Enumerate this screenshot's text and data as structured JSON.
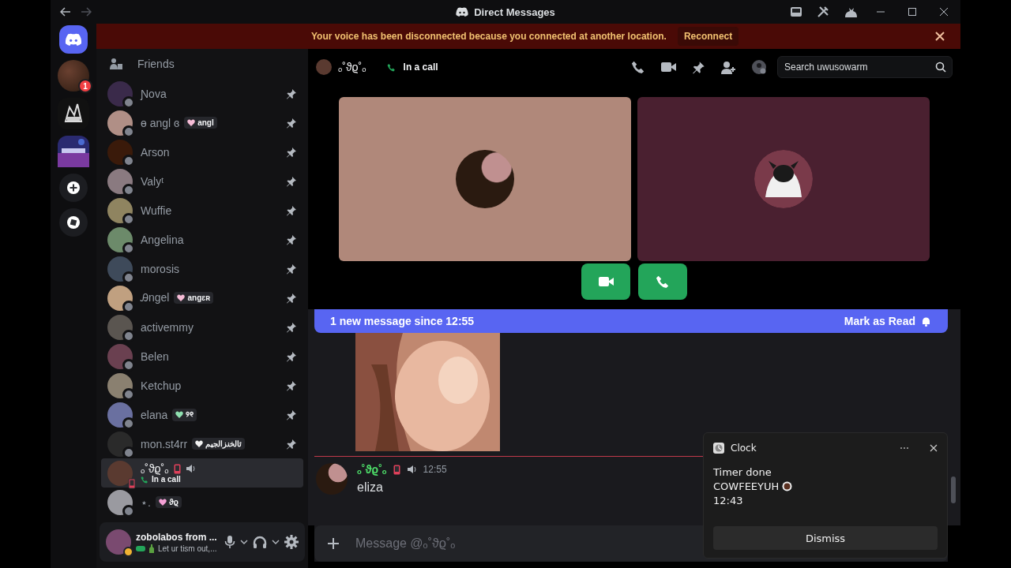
{
  "window": {
    "title": "Direct Messages"
  },
  "banner": {
    "text": "Your voice has been disconnected because you connected at another location.",
    "action": "Reconnect"
  },
  "rail": {
    "dm_badge": "1"
  },
  "sidebar": {
    "friends_label": "Friends",
    "items": [
      {
        "name": "Ɲova",
        "offline": true,
        "pinned": true,
        "selected": false
      },
      {
        "name": "ɵ angl ɞ",
        "tag": {
          "text": "angl",
          "color": "#f5bcd6"
        },
        "offline": true,
        "pinned": true,
        "selected": false
      },
      {
        "name": "Arson",
        "offline": true,
        "pinned": true,
        "selected": false
      },
      {
        "name": "Valyᵗ",
        "offline": true,
        "pinned": true,
        "selected": false
      },
      {
        "name": "Wuffie",
        "offline": true,
        "pinned": true,
        "selected": false
      },
      {
        "name": "Angelina",
        "offline": true,
        "pinned": true,
        "selected": false
      },
      {
        "name": "morosis",
        "offline": true,
        "pinned": true,
        "selected": false
      },
      {
        "name": "Ꭿngel",
        "tag": {
          "text": "angɛʀ",
          "color": "#f5bcd6"
        },
        "offline": true,
        "pinned": true,
        "selected": false
      },
      {
        "name": "activemmy",
        "offline": true,
        "pinned": true,
        "selected": false
      },
      {
        "name": "Belen",
        "offline": true,
        "pinned": true,
        "selected": false
      },
      {
        "name": "Ketchup",
        "offline": true,
        "pinned": true,
        "selected": false
      },
      {
        "name": "elana",
        "tag": {
          "text": "୨୧",
          "color": "#8fe0b0"
        },
        "offline": true,
        "pinned": true,
        "selected": false
      },
      {
        "name": "mon.st4rr",
        "tag": {
          "text": "ئالخنزالجيم",
          "color": "#f2f2f2"
        },
        "offline": true,
        "pinned": true,
        "selected": false
      },
      {
        "name": "ₒ˚ϑϱ˚ₒ",
        "subtitle": "In a call",
        "offline": false,
        "pinned": false,
        "selected": true
      },
      {
        "name": "⋆.",
        "tag": {
          "text": "ϑϱ",
          "color": "#f5a0d6"
        },
        "offline": true,
        "pinned": false,
        "selected": false
      }
    ]
  },
  "user_panel": {
    "name": "zobolabos from ...",
    "activity": "Let ur tism out,..."
  },
  "header": {
    "name": "ₒ˚ϑϱ˚ₒ",
    "call_status": "In a call",
    "search": {
      "placeholder": "Search uwusowarm"
    }
  },
  "unread_bar": {
    "text": "1 new message since 12:55",
    "action": "Mark as Read"
  },
  "message": {
    "author": "ₒ˚ϑϱ˚ₒ",
    "time": "12:55",
    "text": "eliza"
  },
  "composer": {
    "placeholder": "Message @ₒ˚ϑϱ˚ₒ"
  },
  "notification": {
    "app": "Clock",
    "title": "Timer done",
    "body": "COWFEEYUH",
    "time": "12:43",
    "button": "Dismiss"
  }
}
